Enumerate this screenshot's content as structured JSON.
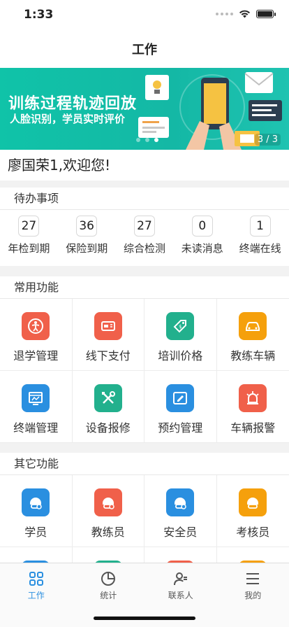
{
  "status": {
    "time": "1:33"
  },
  "nav": {
    "title": "工作"
  },
  "banner": {
    "title": "训练过程轨迹回放",
    "subtitle": "人脸识别，学员实时评价",
    "counter": "3 / 3",
    "slide_index": 3,
    "slide_total": 3
  },
  "welcome": "廖国荣1,欢迎您!",
  "todo": {
    "title": "待办事项",
    "items": [
      {
        "num": "27",
        "label": "年检到期"
      },
      {
        "num": "36",
        "label": "保险到期"
      },
      {
        "num": "27",
        "label": "综合检测"
      },
      {
        "num": "0",
        "label": "未读消息"
      },
      {
        "num": "1",
        "label": "终端在线"
      }
    ]
  },
  "common": {
    "title": "常用功能",
    "items": [
      {
        "label": "退学管理",
        "icon": "person-exit-icon",
        "color": "#f0604a"
      },
      {
        "label": "线下支付",
        "icon": "cash-payment-icon",
        "color": "#f0604a"
      },
      {
        "label": "培训价格",
        "icon": "price-tag-icon",
        "color": "#22b08d"
      },
      {
        "label": "教练车辆",
        "icon": "car-icon",
        "color": "#f5a00c"
      },
      {
        "label": "终端管理",
        "icon": "terminal-monitor-icon",
        "color": "#2a8fe0"
      },
      {
        "label": "设备报修",
        "icon": "repair-tools-icon",
        "color": "#22b08d"
      },
      {
        "label": "预约管理",
        "icon": "appointment-edit-icon",
        "color": "#2a8fe0"
      },
      {
        "label": "车辆报警",
        "icon": "alarm-siren-icon",
        "color": "#f0604a"
      }
    ]
  },
  "other": {
    "title": "其它功能",
    "items": [
      {
        "label": "学员",
        "icon": "student-helmet-icon",
        "color": "#2a8fe0"
      },
      {
        "label": "教练员",
        "icon": "coach-helmet-icon",
        "color": "#f0604a"
      },
      {
        "label": "安全员",
        "icon": "safety-helmet-icon",
        "color": "#2a8fe0"
      },
      {
        "label": "考核员",
        "icon": "examiner-helmet-icon",
        "color": "#f5a00c"
      }
    ]
  },
  "tabs": [
    {
      "label": "工作",
      "icon": "grid-icon",
      "active": true
    },
    {
      "label": "统计",
      "icon": "pie-chart-icon",
      "active": false
    },
    {
      "label": "联系人",
      "icon": "contacts-icon",
      "active": false
    },
    {
      "label": "我的",
      "icon": "menu-icon",
      "active": false
    }
  ]
}
